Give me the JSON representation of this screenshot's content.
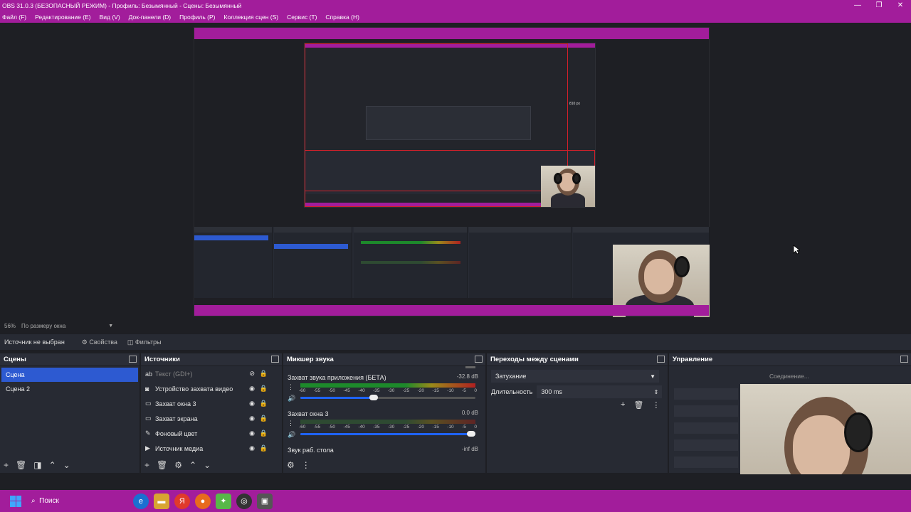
{
  "window": {
    "title": "OBS 31.0.3 (БЕЗОПАСНЫЙ РЕЖИМ) - Профиль: Безымянный - Сцены: Безымянный",
    "controls": [
      "—",
      "❐",
      "✕"
    ]
  },
  "menu": [
    "Файл (F)",
    "Редактирование (E)",
    "Вид (V)",
    "Док-панели (D)",
    "Профиль (P)",
    "Коллекция сцен (S)",
    "Сервис (T)",
    "Справка (H)"
  ],
  "preview": {
    "zoom": "56%",
    "scale_mode": "По размеру окна",
    "nested_label": "810 px"
  },
  "source_bar": {
    "status": "Источник не выбран",
    "properties": "Свойства",
    "filters": "Фильтры"
  },
  "scenes": {
    "title": "Сцены",
    "items": [
      "Сцена",
      "Сцена 2"
    ]
  },
  "sources": {
    "title": "Источники",
    "items": [
      {
        "name": "Текст (GDI+)",
        "icon": "text-icon"
      },
      {
        "name": "Устройство захвата видео",
        "icon": "camera-icon"
      },
      {
        "name": "Захват окна 3",
        "icon": "window-icon"
      },
      {
        "name": "Захват экрана",
        "icon": "monitor-icon"
      },
      {
        "name": "Фоновый цвет",
        "icon": "brush-icon"
      },
      {
        "name": "Источник медиа",
        "icon": "play-icon"
      }
    ]
  },
  "mixer": {
    "title": "Микшер звука",
    "channels": [
      {
        "name": "Захват звука приложения (БЕТА)",
        "db": "-32.8 dB",
        "volume": 0.42
      },
      {
        "name": "Захват окна 3",
        "db": "0.0 dB",
        "volume": 1.0
      }
    ],
    "desktop": {
      "name": "Звук раб. стола",
      "db": "-inf dB"
    },
    "scale": [
      "-60",
      "-55",
      "-50",
      "-45",
      "-40",
      "-35",
      "-30",
      "-25",
      "-20",
      "-15",
      "-10",
      "-5",
      "0"
    ]
  },
  "transitions": {
    "title": "Переходы между сценами",
    "type": "Затухание",
    "duration_label": "Длительность",
    "duration": "300 ms"
  },
  "controls": {
    "title": "Управление",
    "connecting": "Соединение..."
  },
  "taskbar": {
    "search": "Поиск"
  },
  "colors": {
    "accent": "#a21d9b",
    "selection": "#2d5ad1",
    "panel": "#272a33",
    "background": "#1e1f24"
  }
}
